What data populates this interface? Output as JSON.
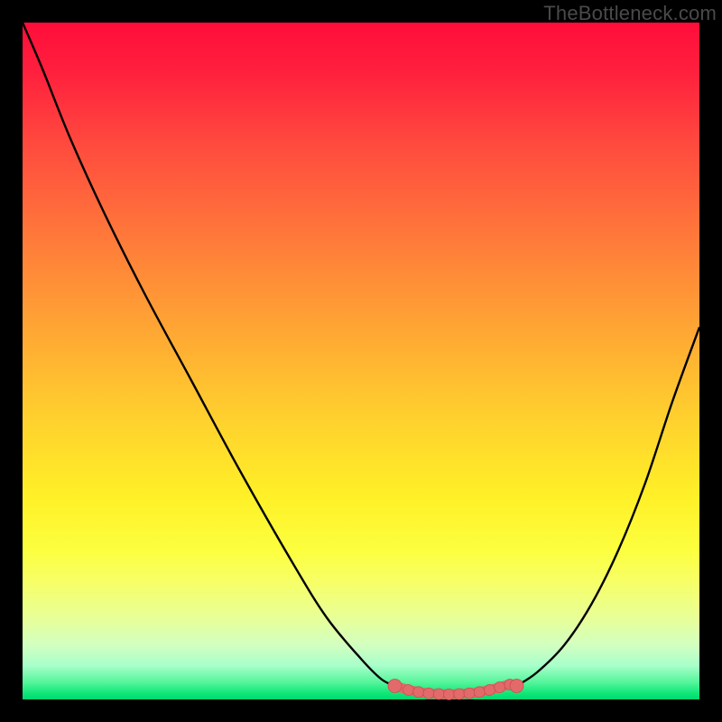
{
  "watermark": "TheBottleneck.com",
  "colors": {
    "background": "#000000",
    "gradient_top": "#ff0d3a",
    "gradient_mid": "#ffd22e",
    "gradient_bottom": "#00d86f",
    "curve_stroke": "#000000",
    "marker_fill": "#e36a6a",
    "marker_stroke": "#c94f4f"
  },
  "chart_data": {
    "type": "line",
    "title": "",
    "xlabel": "",
    "ylabel": "",
    "xlim": [
      0,
      100
    ],
    "ylim": [
      0,
      100
    ],
    "grid": false,
    "legend": false,
    "annotations": [],
    "series": [
      {
        "name": "left-descending-curve",
        "x": [
          0,
          3,
          7,
          12,
          18,
          25,
          32,
          40,
          45,
          50,
          53,
          55
        ],
        "y": [
          100,
          93,
          83,
          72,
          60,
          47,
          34,
          20,
          12,
          6,
          3,
          2
        ]
      },
      {
        "name": "right-ascending-curve",
        "x": [
          73,
          76,
          80,
          84,
          88,
          92,
          96,
          100
        ],
        "y": [
          2,
          4,
          8,
          14,
          22,
          32,
          44,
          55
        ]
      },
      {
        "name": "trough-markers",
        "x": [
          55,
          57,
          58.5,
          60,
          61.5,
          63,
          64.5,
          66,
          67.5,
          69,
          70.5,
          72,
          73
        ],
        "y": [
          2.0,
          1.4,
          1.1,
          0.9,
          0.8,
          0.75,
          0.8,
          0.9,
          1.1,
          1.4,
          1.8,
          2.2,
          2.0
        ]
      }
    ]
  }
}
